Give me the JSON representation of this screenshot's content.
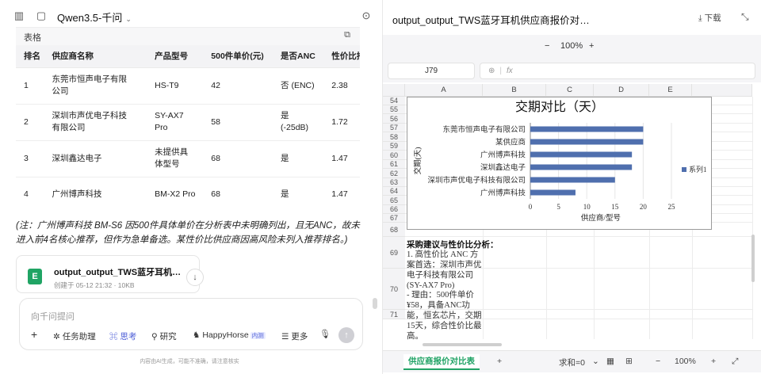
{
  "header": {
    "model_name": "Qwen3.5-千问",
    "sidebar_icon": "sidebar-toggle-icon",
    "chat_icon": "new-chat-icon",
    "history_icon": "history-icon"
  },
  "table_card": {
    "label": "表格",
    "columns": [
      "排名",
      "供应商名称",
      "产品型号",
      "500件单价(元)",
      "是否ANC",
      "性价比指数"
    ],
    "rows": [
      [
        "1",
        "东莞市恒声电子有限公司",
        "HS-T9",
        "42",
        "否 (ENC)",
        "2.38"
      ],
      [
        "2",
        "深圳市声优电子科技有限公司",
        "SY-AX7 Pro",
        "58",
        "是 (-25dB)",
        "1.72"
      ],
      [
        "3",
        "深圳鑫达电子",
        "未提供具体型号",
        "68",
        "是",
        "1.47"
      ],
      [
        "4",
        "广州博声科技",
        "BM-X2 Pro",
        "68",
        "是",
        "1.47"
      ]
    ]
  },
  "note": "(注：广州博声科技 BM-S6 因500件具体单价在分析表中未明确列出，且无ANC，故未进入前4名核心推荐，但作为急单备选。某性价比供应商因高风险未列入推荐排名。)",
  "file_card": {
    "icon_letter": "E",
    "name": "output_output_TWS蓝牙耳机供应商报价对比表_w…",
    "meta": "创建于 05-12 21:32 · 10KB"
  },
  "composer": {
    "placeholder": "向千问提问",
    "tools": [
      {
        "label": "任务助理",
        "active": false
      },
      {
        "label": "思考",
        "active": true
      },
      {
        "label": "研究",
        "active": false
      },
      {
        "label": "HappyHorse",
        "badge": "内测",
        "active": false
      },
      {
        "label": "更多",
        "active": false
      }
    ]
  },
  "disclaimer": "内容由AI生成，可能不准确，请注意核实",
  "spreadsheet": {
    "title": "output_output_TWS蓝牙耳机供应商报价对比表_w…",
    "download_label": "下载",
    "zoom": "100%",
    "cell_ref": "J79",
    "fx_label": "fx",
    "columns": [
      "A",
      "B",
      "C",
      "D",
      "E"
    ],
    "rows": [
      "54",
      "55",
      "56",
      "57",
      "58",
      "59",
      "60",
      "61",
      "62",
      "63",
      "64",
      "65",
      "66",
      "67",
      "68",
      "69",
      "70",
      "71"
    ],
    "advice_title": "采购建议与性价比分析：",
    "advice_1": "1. 高性价比 ANC 方案首选：深圳市声优电子科技有限公司(SY-AX7 Pro)",
    "advice_2": "  - 理由：500件单价¥58，具备ANC功能，恒玄芯片，交期15天，综合性价比最高。",
    "sheet_tab": "供应商报价对比表",
    "status_sum": "求和=0",
    "status_zoom": "100%"
  },
  "chart_data": {
    "type": "bar",
    "orientation": "horizontal",
    "title": "交期对比（天）",
    "xlabel": "供应商/型号",
    "ylabel": "交期(天)",
    "categories": [
      "东莞市恒声电子有限公司",
      "某供应商",
      "广州博声科技",
      "深圳鑫达电子",
      "深圳市声优电子科技有限公司",
      "广州博声科技"
    ],
    "series": [
      {
        "name": "系列1",
        "values": [
          20,
          20,
          18,
          18,
          15,
          8
        ],
        "color": "#4f6fae"
      }
    ],
    "xlim": [
      0,
      25
    ],
    "xticks": [
      0,
      5,
      10,
      15,
      20,
      25
    ],
    "legend_position": "right"
  }
}
